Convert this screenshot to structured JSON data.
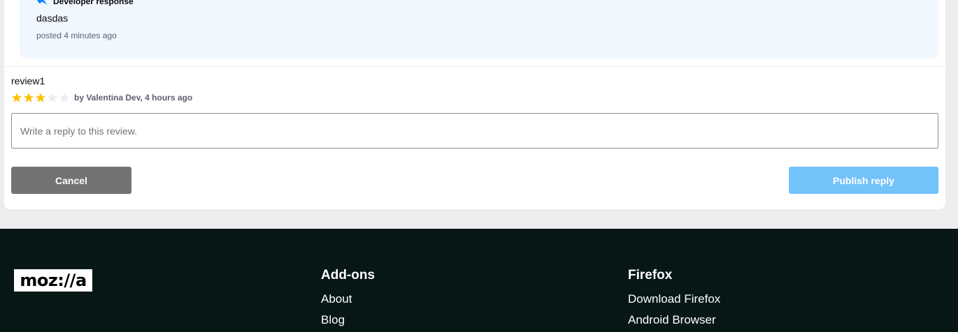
{
  "developer_response": {
    "header": "Developer response",
    "body": "dasdas",
    "meta": "posted 4 minutes ago"
  },
  "review": {
    "title": "review1",
    "rating": 3,
    "max_rating": 5,
    "byline": "by Valentina Dev, 4 hours ago",
    "star_color_filled": "#ffc108",
    "star_color_empty": "#ededf0"
  },
  "reply_form": {
    "placeholder": "Write a reply to this review.",
    "value": "",
    "cancel_label": "Cancel",
    "publish_label": "Publish reply"
  },
  "footer": {
    "logo_text": "moz://a",
    "columns": [
      {
        "heading": "Add-ons",
        "links": [
          "About",
          "Blog"
        ]
      },
      {
        "heading": "Firefox",
        "links": [
          "Download Firefox",
          "Android Browser"
        ]
      }
    ]
  }
}
